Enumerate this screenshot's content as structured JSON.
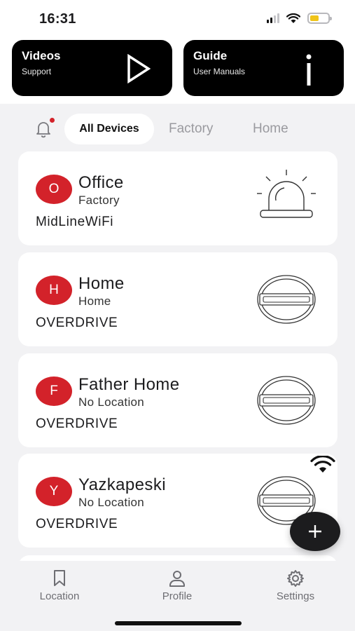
{
  "status_bar": {
    "time": "16:31"
  },
  "promos": [
    {
      "title": "Videos",
      "subtitle": "Support",
      "icon": "play-icon"
    },
    {
      "title": "Guide",
      "subtitle": "User Manuals",
      "icon": "info-icon"
    }
  ],
  "filters": {
    "notification_icon": "bell-icon",
    "tabs": [
      {
        "label": "All Devices",
        "active": true
      },
      {
        "label": "Factory",
        "active": false
      },
      {
        "label": "Home",
        "active": false
      }
    ]
  },
  "devices": [
    {
      "initial": "O",
      "name": "Office",
      "location": "Factory",
      "type": "MidLineWiFi",
      "icon": "siren-light-icon"
    },
    {
      "initial": "H",
      "name": "Home",
      "location": "Home",
      "type": "OVERDRIVE",
      "icon": "overdrive-device-icon"
    },
    {
      "initial": "F",
      "name": "Father Home",
      "location": "No Location",
      "type": "OVERDRIVE",
      "icon": "overdrive-device-icon"
    },
    {
      "initial": "Y",
      "name": "Yazkapeski",
      "location": "No Location",
      "type": "OVERDRIVE",
      "icon": "overdrive-device-icon"
    }
  ],
  "tab_bar": {
    "items": [
      {
        "label": "Location",
        "icon": "bookmark-icon"
      },
      {
        "label": "Profile",
        "icon": "person-icon"
      },
      {
        "label": "Settings",
        "icon": "gear-icon"
      }
    ]
  },
  "colors": {
    "accent": "#d3222a",
    "dark": "#000000",
    "background": "#f2f2f4"
  }
}
